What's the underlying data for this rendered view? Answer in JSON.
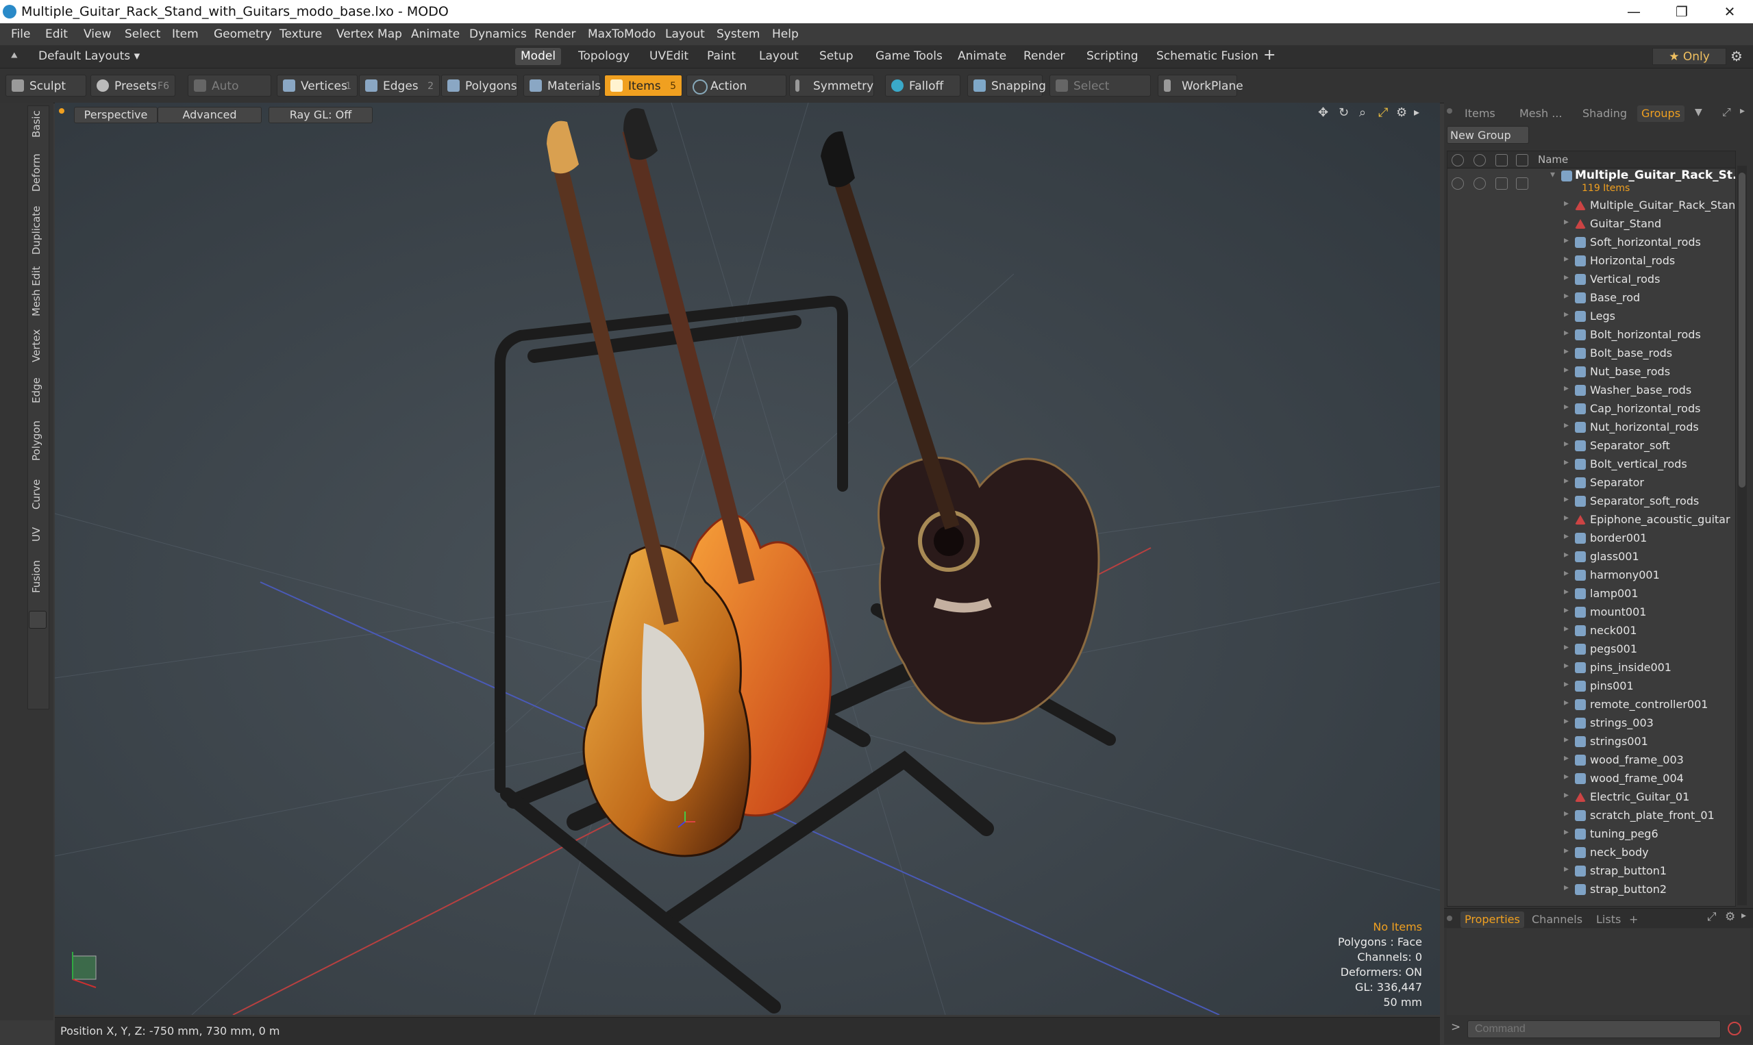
{
  "window": {
    "title": "Multiple_Guitar_Rack_Stand_with_Guitars_modo_base.lxo - MODO",
    "minimize": "—",
    "maximize": "❐",
    "close": "✕"
  },
  "menu": [
    "File",
    "Edit",
    "View",
    "Select",
    "Item",
    "Geometry",
    "Texture",
    "Vertex Map",
    "Animate",
    "Dynamics",
    "Render",
    "MaxToModo",
    "Layout",
    "System",
    "Help"
  ],
  "layouts": {
    "default_layouts": "Default Layouts ▾",
    "tabs": [
      "Model",
      "Topology",
      "UVEdit",
      "Paint",
      "Layout",
      "Setup",
      "Game Tools",
      "Animate",
      "Render",
      "Scripting",
      "Schematic Fusion"
    ],
    "active": "Model",
    "add": "+",
    "only": "★  Only"
  },
  "toolbar": {
    "sculpt": "Sculpt",
    "presets": "Presets",
    "presets_key": "F6",
    "auto_select": "Auto Select",
    "vertices": "Vertices",
    "vertices_count": "1",
    "edges": "Edges",
    "edges_count": "2",
    "polygons": "Polygons",
    "materials": "Materials",
    "items": "Items",
    "items_count": "5",
    "action_center": "Action Center",
    "symmetry": "Symmetry",
    "falloff": "Falloff",
    "snapping": "Snapping",
    "select_through": "Select Through",
    "workplane": "WorkPlane"
  },
  "left_tabs": [
    "Basic",
    "Deform",
    "Duplicate",
    "Mesh Edit",
    "Vertex",
    "Edge",
    "Polygon",
    "Curve",
    "UV",
    "Fusion"
  ],
  "viewport": {
    "view_mode": "Perspective",
    "shading": "Advanced",
    "raygl": "Ray GL: Off",
    "hud": {
      "selection": "No Items",
      "polygons": "Polygons : Face",
      "channels": "Channels: 0",
      "deformers": "Deformers: ON",
      "gl": "GL: 336,447",
      "scale": "50 mm"
    }
  },
  "status": {
    "position": "Position X, Y, Z:  -750 mm, 730 mm, 0 m"
  },
  "right_panel": {
    "tabs": [
      "Items",
      "Mesh ...",
      "Shading",
      "Groups"
    ],
    "active_tab": "Groups",
    "new_group": "New Group",
    "name_header": "Name",
    "root": {
      "name": "Multiple_Guitar_Rack_St...",
      "count": "119 Items"
    },
    "items": [
      {
        "name": "Multiple_Guitar_Rack_Stan ...",
        "type": "locator"
      },
      {
        "name": "Guitar_Stand",
        "type": "locator"
      },
      {
        "name": "Soft_horizontal_rods",
        "type": "mesh"
      },
      {
        "name": "Horizontal_rods",
        "type": "mesh"
      },
      {
        "name": "Vertical_rods",
        "type": "mesh"
      },
      {
        "name": "Base_rod",
        "type": "mesh"
      },
      {
        "name": "Legs",
        "type": "mesh"
      },
      {
        "name": "Bolt_horizontal_rods",
        "type": "mesh"
      },
      {
        "name": "Bolt_base_rods",
        "type": "mesh"
      },
      {
        "name": "Nut_base_rods",
        "type": "mesh"
      },
      {
        "name": "Washer_base_rods",
        "type": "mesh"
      },
      {
        "name": "Cap_horizontal_rods",
        "type": "mesh"
      },
      {
        "name": "Nut_horizontal_rods",
        "type": "mesh"
      },
      {
        "name": "Separator_soft",
        "type": "mesh"
      },
      {
        "name": "Bolt_vertical_rods",
        "type": "mesh"
      },
      {
        "name": "Separator",
        "type": "mesh"
      },
      {
        "name": "Separator_soft_rods",
        "type": "mesh"
      },
      {
        "name": "Epiphone_acoustic_guitar",
        "type": "locator"
      },
      {
        "name": "border001",
        "type": "mesh"
      },
      {
        "name": "glass001",
        "type": "mesh"
      },
      {
        "name": "harmony001",
        "type": "mesh"
      },
      {
        "name": "lamp001",
        "type": "mesh"
      },
      {
        "name": "mount001",
        "type": "mesh"
      },
      {
        "name": "neck001",
        "type": "mesh"
      },
      {
        "name": "pegs001",
        "type": "mesh"
      },
      {
        "name": "pins_inside001",
        "type": "mesh"
      },
      {
        "name": "pins001",
        "type": "mesh"
      },
      {
        "name": "remote_controller001",
        "type": "mesh"
      },
      {
        "name": "strings_003",
        "type": "mesh"
      },
      {
        "name": "strings001",
        "type": "mesh"
      },
      {
        "name": "wood_frame_003",
        "type": "mesh"
      },
      {
        "name": "wood_frame_004",
        "type": "mesh"
      },
      {
        "name": "Electric_Guitar_01",
        "type": "locator"
      },
      {
        "name": "scratch_plate_front_01",
        "type": "mesh"
      },
      {
        "name": "tuning_peg6",
        "type": "mesh"
      },
      {
        "name": "neck_body",
        "type": "mesh"
      },
      {
        "name": "strap_button1",
        "type": "mesh"
      },
      {
        "name": "strap_button2",
        "type": "mesh"
      }
    ],
    "bottom_tabs": [
      "Properties",
      "Channels",
      "Lists"
    ],
    "bottom_active": "Properties",
    "bottom_add": "+",
    "command_placeholder": "Command"
  },
  "colors": {
    "accent": "#f0a020",
    "viewport_bg": "#3f474e"
  }
}
